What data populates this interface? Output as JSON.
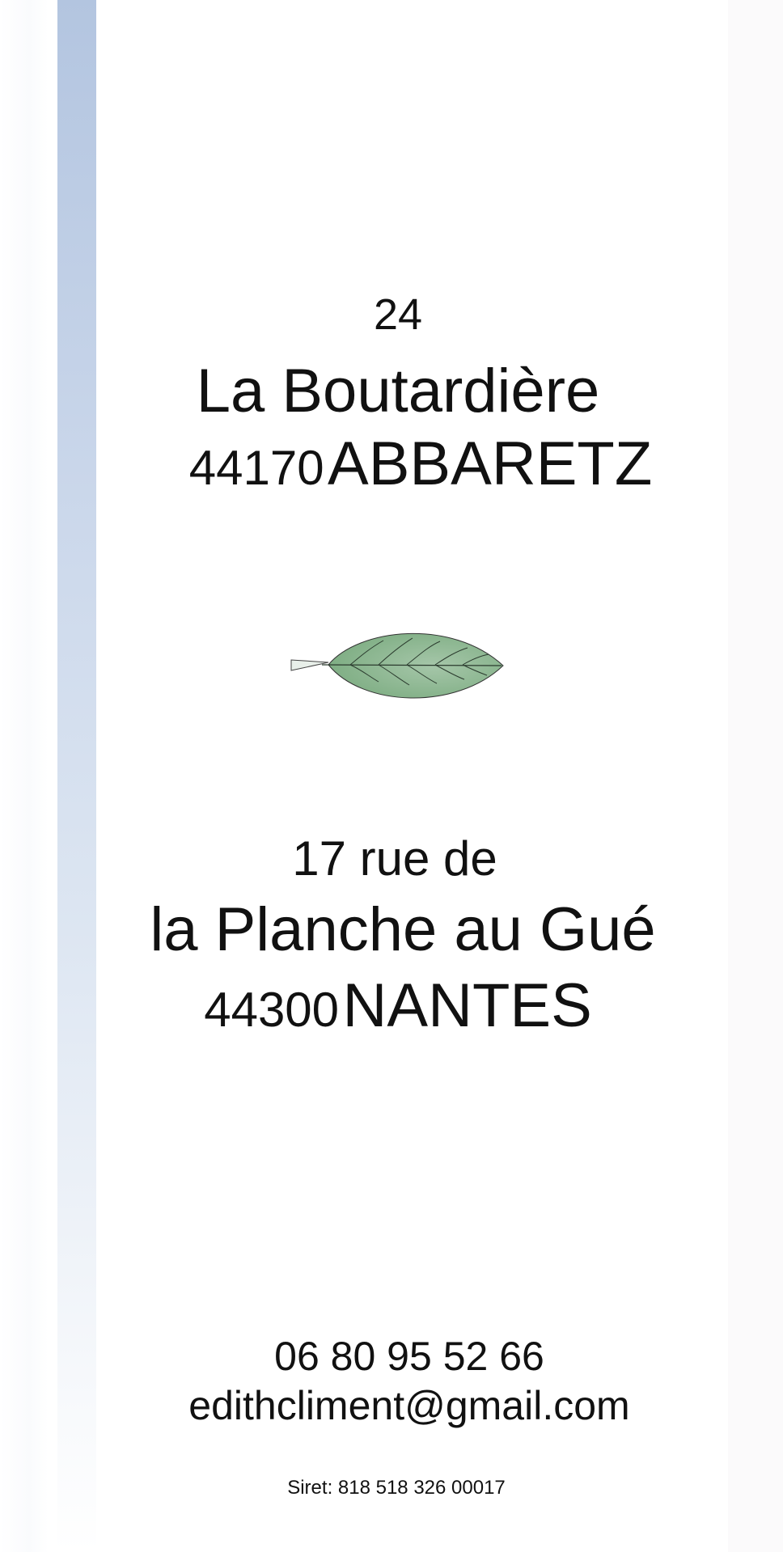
{
  "address1": {
    "number": "24",
    "street": "La Boutardière",
    "postcode": "44170",
    "city": "ABBARETZ"
  },
  "address2": {
    "line1": "17 rue de",
    "street": "la Planche au Gué",
    "postcode": "44300",
    "city": "NANTES"
  },
  "contact": {
    "phone": "06 80 95 52 66",
    "email": "edithcliment@gmail.com"
  },
  "siret": "Siret: 818 518 326 00017",
  "decoration": {
    "icon": "leaf-icon",
    "leaf_color": "#7fae84",
    "band_color": "#b3c5e0"
  }
}
